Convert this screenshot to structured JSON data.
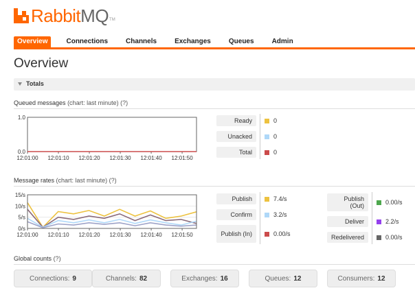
{
  "logo": {
    "rabbit": "Rabbit",
    "mq": "MQ",
    "tm": "TM"
  },
  "tabs": [
    {
      "label": "Overview",
      "active": true
    },
    {
      "label": "Connections"
    },
    {
      "label": "Channels"
    },
    {
      "label": "Exchanges"
    },
    {
      "label": "Queues"
    },
    {
      "label": "Admin"
    }
  ],
  "page_title": "Overview",
  "totals_section": {
    "label": "Totals"
  },
  "queued_messages": {
    "title": "Queued messages",
    "subtitle": "(chart: last minute)",
    "help": "(?)",
    "legend": [
      {
        "label": "Ready",
        "value": "0",
        "color": "#edc240"
      },
      {
        "label": "Unacked",
        "value": "0",
        "color": "#afd8f8"
      },
      {
        "label": "Total",
        "value": "0",
        "color": "#cb4b4b"
      }
    ]
  },
  "message_rates": {
    "title": "Message rates",
    "subtitle": "(chart: last minute)",
    "help": "(?)",
    "legend_left": [
      {
        "label": "Publish",
        "value": "7.4/s",
        "color": "#edc240"
      },
      {
        "label": "Confirm",
        "value": "3.2/s",
        "color": "#afd8f8"
      },
      {
        "label": "Publish (In)",
        "value": "0.00/s",
        "color": "#cb4b4b"
      }
    ],
    "legend_right": [
      {
        "label": "Publish (Out)",
        "value": "0.00/s",
        "color": "#4da74d"
      },
      {
        "label": "Deliver",
        "value": "2.2/s",
        "color": "#9440ed"
      },
      {
        "label": "Redelivered",
        "value": "0.00/s",
        "color": "#666666"
      }
    ]
  },
  "global_counts": {
    "title": "Global counts",
    "help": "(?)",
    "items": [
      {
        "label": "Connections:",
        "value": "9"
      },
      {
        "label": "Channels:",
        "value": "82"
      },
      {
        "label": "Exchanges:",
        "value": "16"
      },
      {
        "label": "Queues:",
        "value": "12"
      },
      {
        "label": "Consumers:",
        "value": "12"
      }
    ]
  },
  "chart_data": [
    {
      "type": "line",
      "x": [
        "12:01:00",
        "12:01:10",
        "12:01:20",
        "12:01:30",
        "12:01:40",
        "12:01:50"
      ],
      "ylim": [
        0,
        1.0
      ],
      "yticks": [
        "0.0",
        "1.0"
      ],
      "series": [
        {
          "name": "Total",
          "color": "#cb4b4b",
          "values": [
            0,
            0,
            0,
            0,
            0,
            0
          ]
        }
      ]
    },
    {
      "type": "line",
      "x": [
        "12:01:00",
        "12:01:10",
        "12:01:20",
        "12:01:30",
        "12:01:40",
        "12:01:50"
      ],
      "ylim": [
        0,
        15
      ],
      "yticks": [
        "0/s",
        "5/s",
        "10/s",
        "15/s"
      ],
      "series": [
        {
          "name": "Publish",
          "color": "#edc240",
          "values": [
            11.5,
            0.5,
            7.5,
            6.5,
            8,
            5.5,
            8.5,
            5.5,
            7.8,
            4.5,
            5.5,
            7.4
          ]
        },
        {
          "name": "Deliver",
          "color": "#8a6a7a",
          "values": [
            8.5,
            0.5,
            5,
            4,
            5.5,
            4.5,
            6.5,
            3.5,
            6,
            3.5,
            4,
            2.2
          ]
        },
        {
          "name": "Confirm",
          "color": "#afd8f8",
          "values": [
            4.5,
            0.5,
            3.5,
            2.5,
            3.8,
            2.5,
            4,
            2.2,
            3.8,
            2.5,
            1.5,
            3.2
          ]
        },
        {
          "name": "Redelivered",
          "color": "#9ea3c8",
          "values": [
            3,
            0.3,
            2,
            1.5,
            2.5,
            1.8,
            2.5,
            1.2,
            2.5,
            1.5,
            1,
            1.5
          ]
        }
      ]
    }
  ]
}
